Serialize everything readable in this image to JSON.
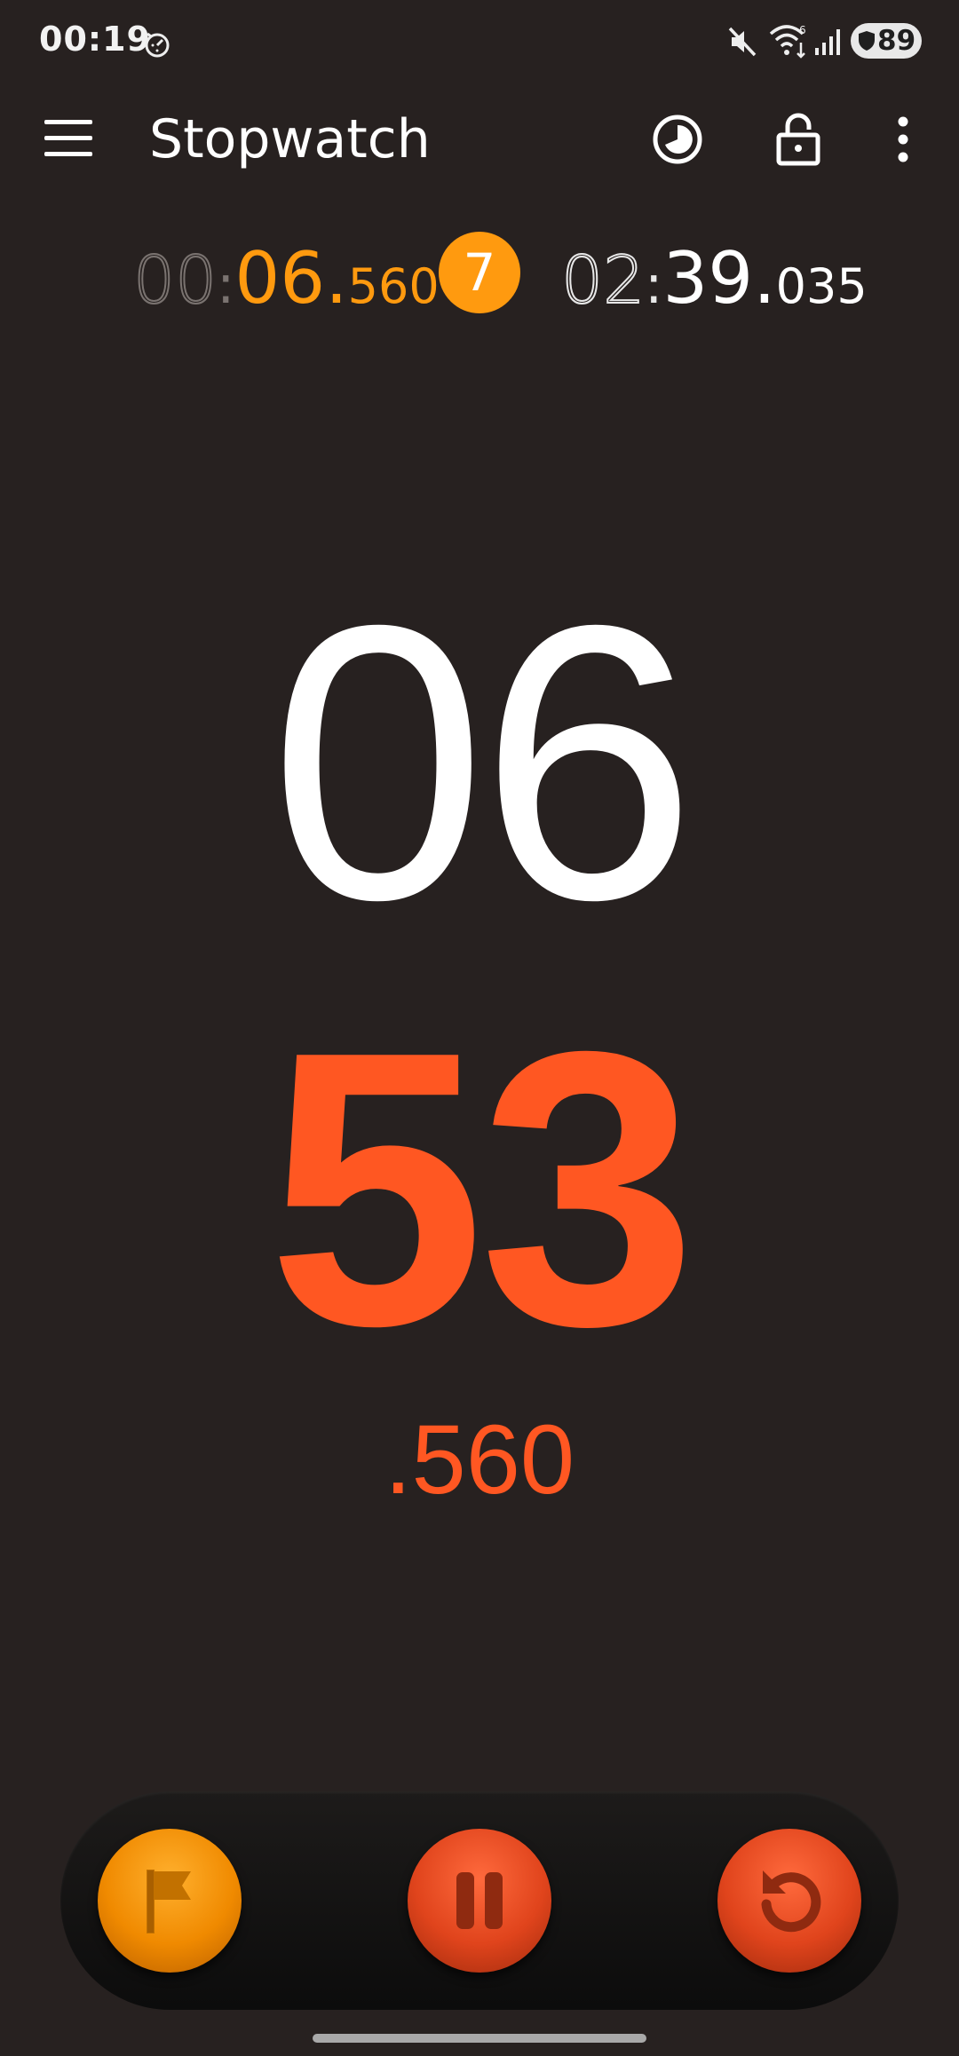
{
  "status_bar": {
    "time": "00:19",
    "battery_level": "89",
    "icons": [
      "stopwatch-running-icon",
      "mute-icon",
      "wifi-icon",
      "signal-icon",
      "battery-icon"
    ]
  },
  "toolbar": {
    "title": "Stopwatch",
    "icons": [
      "menu-icon",
      "theme-icon",
      "lock-icon",
      "more-options-icon"
    ]
  },
  "lap": {
    "lap_time_dim": "00",
    "lap_time_seconds": "06.",
    "lap_time_ms": "560",
    "lap_number": "7",
    "total_time_dim": "02",
    "total_time_seconds": "39.",
    "total_time_ms": "035"
  },
  "main_display": {
    "minutes": "06",
    "seconds": "53",
    "milliseconds": ".560"
  },
  "controls": {
    "buttons": [
      "lap-flag-icon",
      "pause-icon",
      "reset-icon"
    ]
  },
  "colors": {
    "background": "#272120",
    "accent_orange": "#ff9a0f",
    "accent_red": "#ff5722"
  }
}
